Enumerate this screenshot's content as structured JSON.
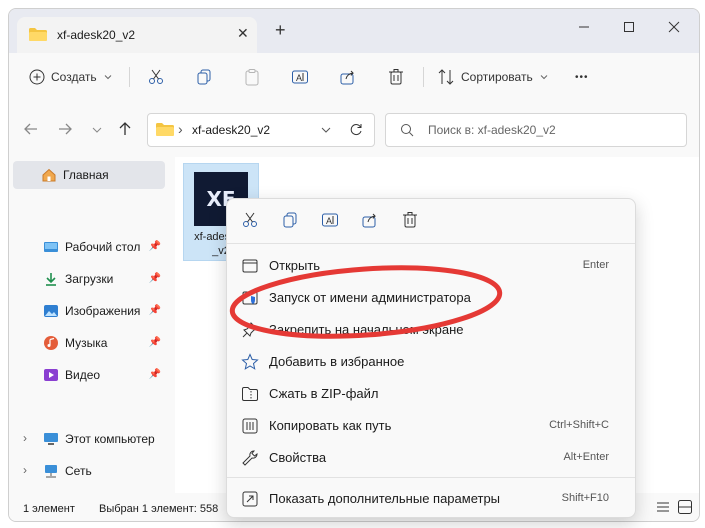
{
  "window": {
    "tab_title": "xf-adesk20_v2",
    "tab_close_glyph": "✕",
    "new_tab_glyph": "+"
  },
  "toolbar": {
    "create_label": "Создать",
    "sort_label": "Сортировать",
    "more_glyph": "•••"
  },
  "address": {
    "sep_glyph": "›",
    "path": "xf-adesk20_v2",
    "search_placeholder": "Поиск в: xf-adesk20_v2"
  },
  "sidebar": {
    "home": "Главная",
    "items": [
      {
        "label": "Рабочий стол",
        "icon": "desktop-icon"
      },
      {
        "label": "Загрузки",
        "icon": "download-icon"
      },
      {
        "label": "Изображения",
        "icon": "pictures-icon"
      },
      {
        "label": "Музыка",
        "icon": "music-icon"
      },
      {
        "label": "Видео",
        "icon": "video-icon"
      }
    ],
    "computer": "Этот компьютер",
    "network": "Сеть"
  },
  "content": {
    "file_thumb_text": "XF",
    "file_name_line1": "xf-adesk20",
    "file_name_line2": "_v2"
  },
  "status": {
    "count": "1 элемент",
    "selected": "Выбран 1 элемент: 558"
  },
  "context_menu": {
    "items": [
      {
        "label": "Открыть",
        "shortcut": "Enter",
        "icon": "open-icon"
      },
      {
        "label": "Запуск от имени администратора",
        "shortcut": "",
        "icon": "shield-icon"
      },
      {
        "label": "Закрепить на начальном экране",
        "shortcut": "",
        "icon": "pin-icon"
      },
      {
        "label": "Добавить в избранное",
        "shortcut": "",
        "icon": "star-icon"
      },
      {
        "label": "Сжать в ZIP-файл",
        "shortcut": "",
        "icon": "zip-icon"
      },
      {
        "label": "Копировать как путь",
        "shortcut": "Ctrl+Shift+C",
        "icon": "copy-path-icon"
      },
      {
        "label": "Свойства",
        "shortcut": "Alt+Enter",
        "icon": "wrench-icon"
      }
    ],
    "more": {
      "label": "Показать дополнительные параметры",
      "shortcut": "Shift+F10"
    }
  },
  "colors": {
    "highlight": "#e53935",
    "accent": "#0067c0",
    "selection": "#cce4f7"
  }
}
